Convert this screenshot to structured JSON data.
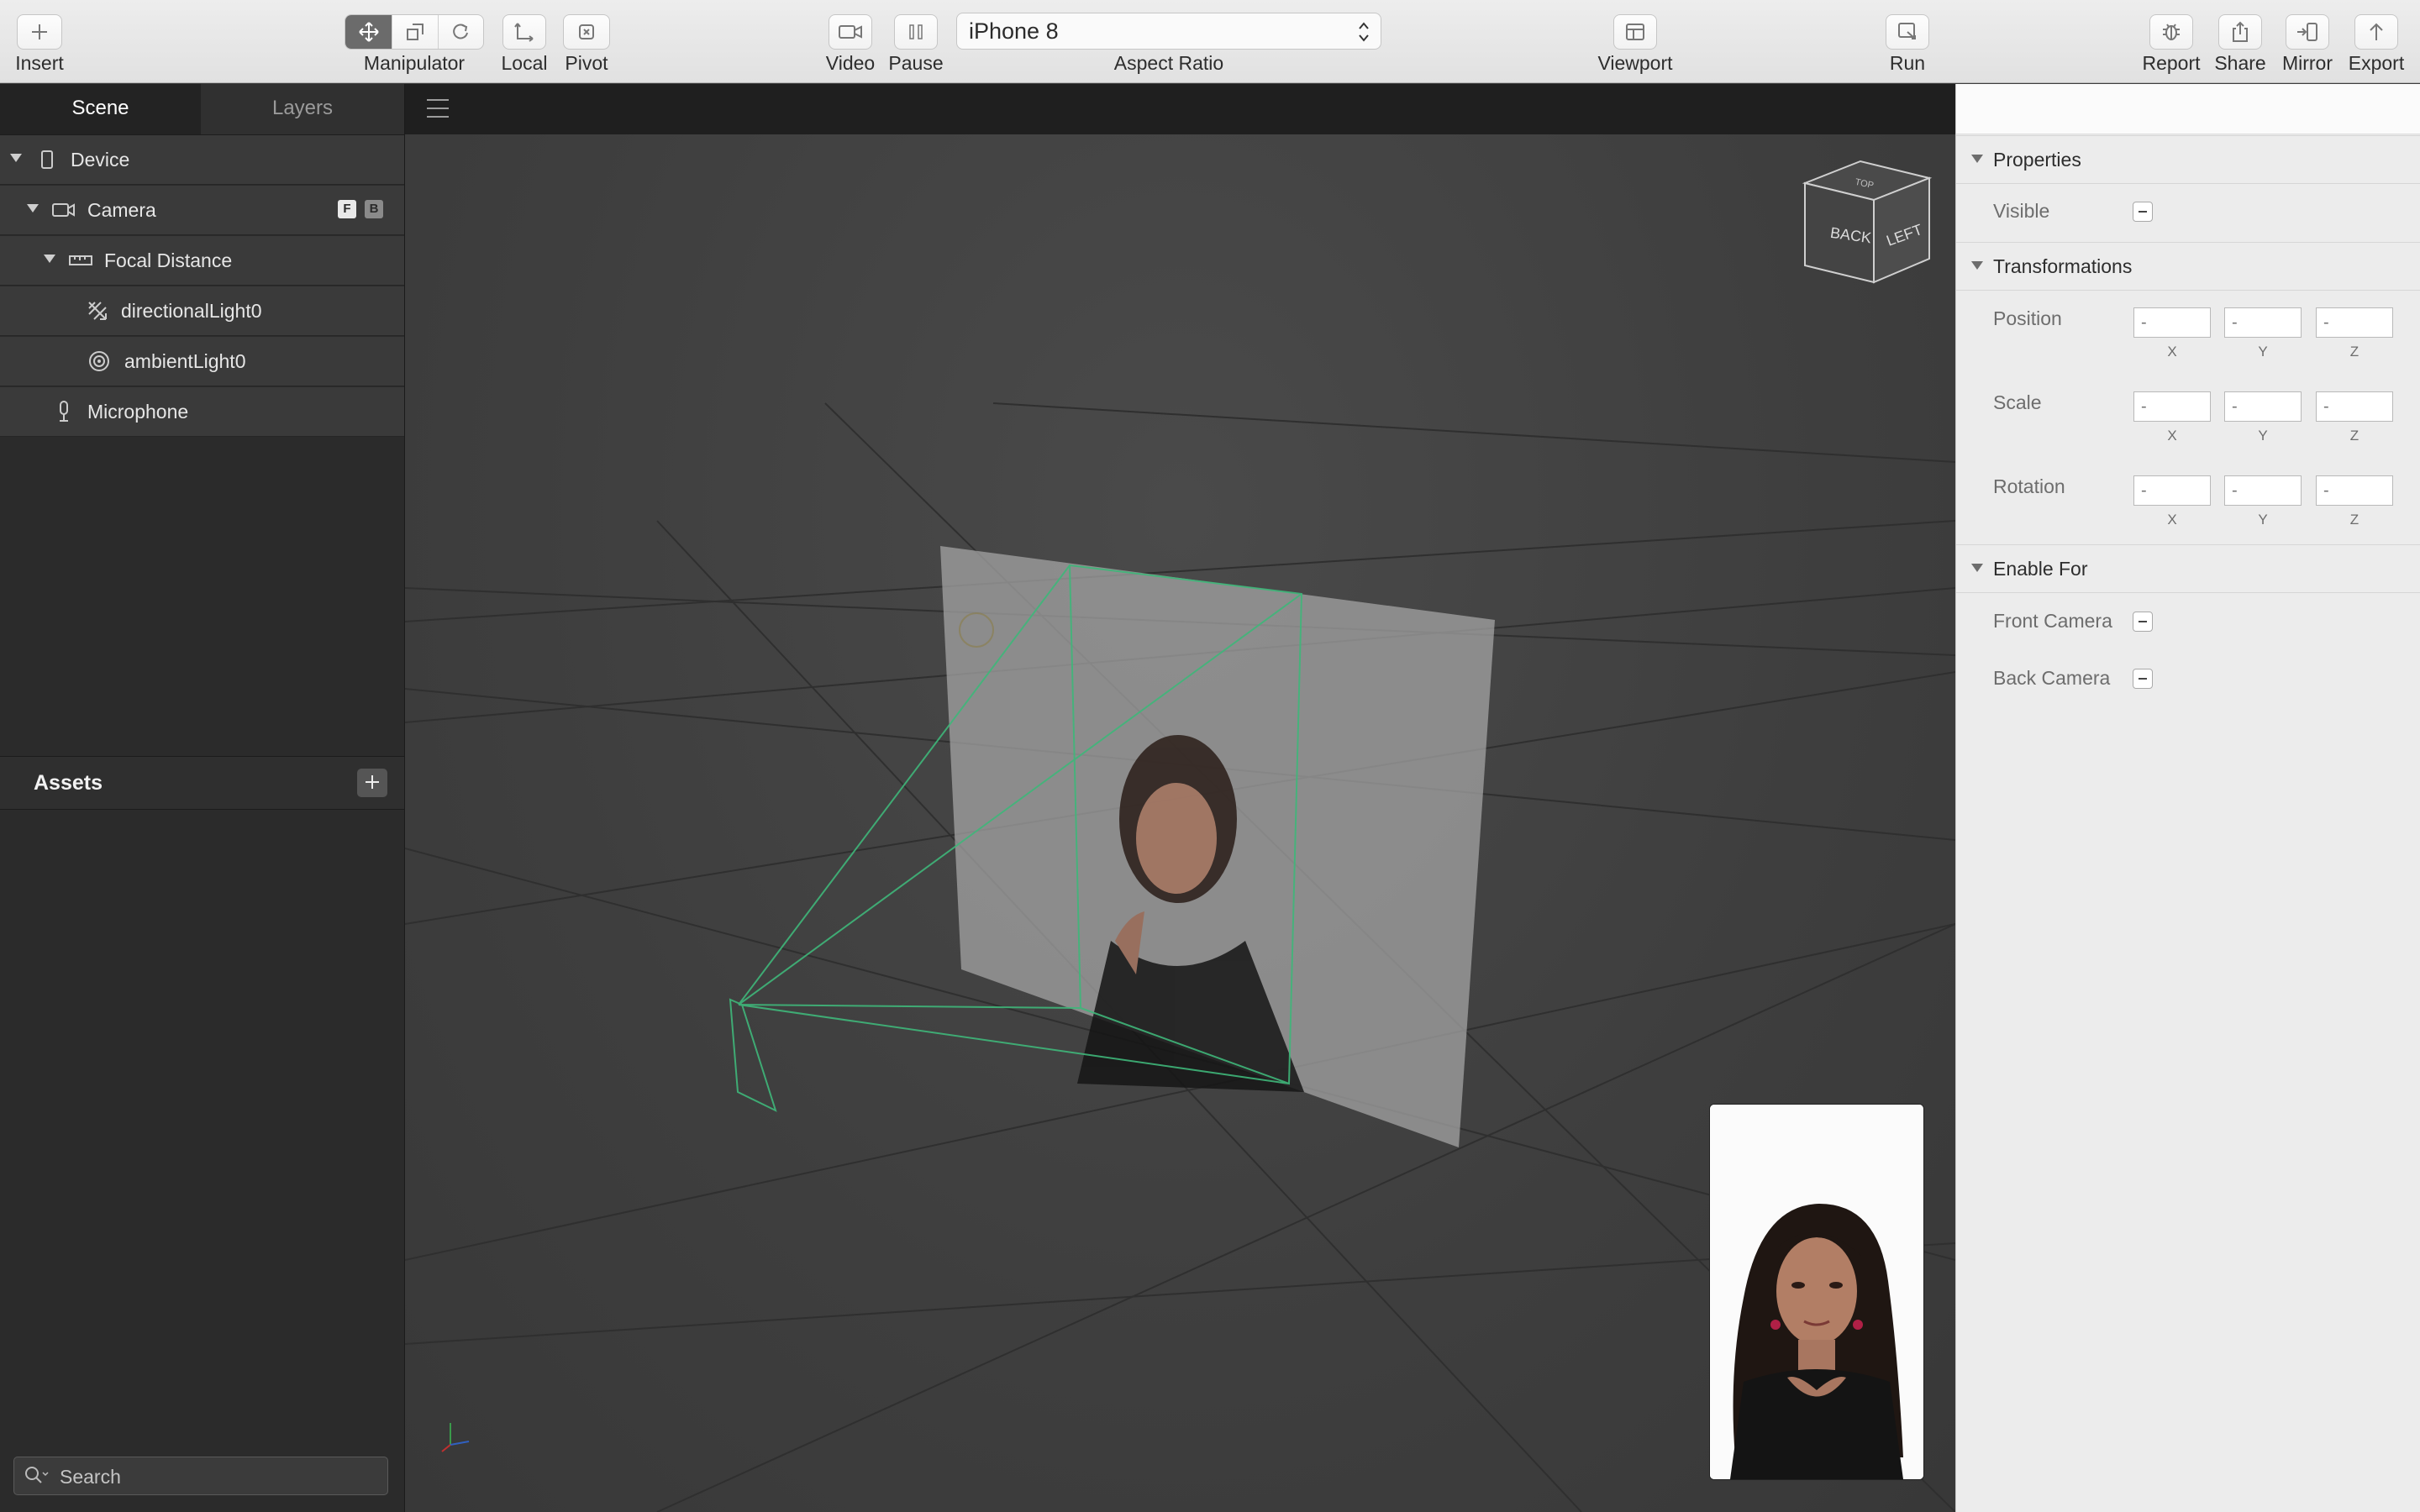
{
  "toolbar": {
    "insert": "Insert",
    "manipulator": "Manipulator",
    "local": "Local",
    "pivot": "Pivot",
    "video": "Video",
    "pause": "Pause",
    "aspect_value": "iPhone 8",
    "aspect_label": "Aspect Ratio",
    "viewport": "Viewport",
    "run": "Run",
    "report": "Report",
    "share": "Share",
    "mirror": "Mirror",
    "export": "Export"
  },
  "left_panel": {
    "tabs": [
      "Scene",
      "Layers"
    ],
    "active_tab": "Scene",
    "tree": [
      {
        "label": "Device",
        "icon": "phone-icon"
      },
      {
        "label": "Camera",
        "icon": "camera-icon",
        "badges": [
          "F",
          "B"
        ]
      },
      {
        "label": "Focal Distance",
        "icon": "ruler-icon"
      },
      {
        "label": "directionalLight0",
        "icon": "directional-light-icon"
      },
      {
        "label": "ambientLight0",
        "icon": "ambient-light-icon"
      },
      {
        "label": "Microphone",
        "icon": "microphone-icon"
      }
    ],
    "assets_title": "Assets",
    "search_placeholder": "Search"
  },
  "viewport": {
    "cube_faces": [
      "BACK",
      "LEFT",
      "TOP"
    ]
  },
  "inspector": {
    "properties_title": "Properties",
    "visible_label": "Visible",
    "transformations_title": "Transformations",
    "position_label": "Position",
    "scale_label": "Scale",
    "rotation_label": "Rotation",
    "field_placeholder": "-",
    "axes": [
      "X",
      "Y",
      "Z"
    ],
    "enable_for_title": "Enable For",
    "front_camera_label": "Front Camera",
    "back_camera_label": "Back Camera"
  },
  "colors": {
    "accent_green": "#3fb77a",
    "panel_dark": "#2b2b2b",
    "inspector_bg": "#ececec"
  }
}
